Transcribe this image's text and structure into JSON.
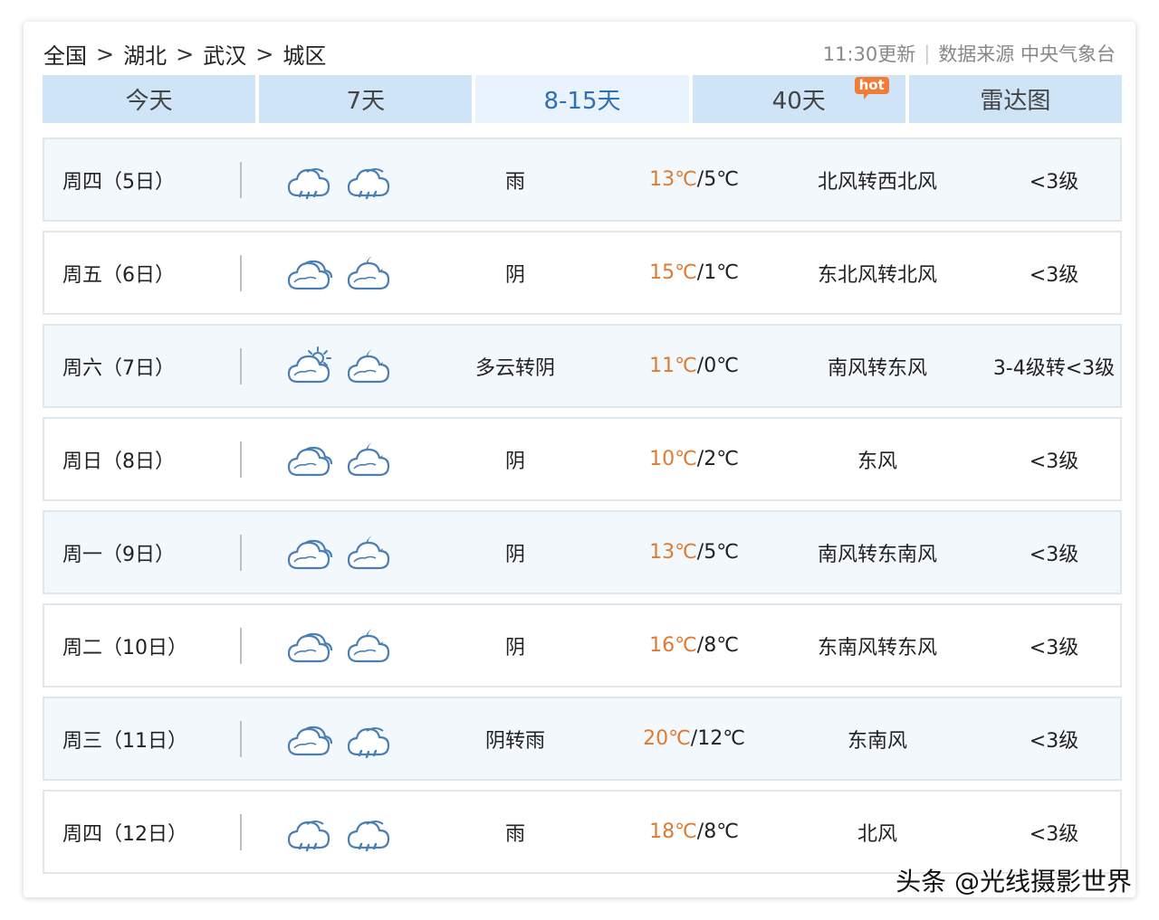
{
  "breadcrumb": [
    "全国",
    "湖北",
    "武汉",
    "城区"
  ],
  "breadcrumb_sep": ">",
  "meta": {
    "updated": "11:30更新",
    "divider": "|",
    "source": "数据来源 中央气象台"
  },
  "tabs": [
    {
      "label": "今天",
      "active": false
    },
    {
      "label": "7天",
      "active": false
    },
    {
      "label": "8-15天",
      "active": true
    },
    {
      "label": "40天",
      "active": false,
      "badge": "hot"
    },
    {
      "label": "雷达图",
      "active": false
    }
  ],
  "rows": [
    {
      "day": "周四（5日）",
      "icon_day": "rain-icon",
      "icon_night": "rain-icon",
      "weather": "雨",
      "high": "13℃",
      "low": "/5℃",
      "wind": "北风转西北风",
      "level": "<3级"
    },
    {
      "day": "周五（6日）",
      "icon_day": "overcast-icon",
      "icon_night": "cloudy-night-icon",
      "weather": "阴",
      "high": "15℃",
      "low": "/1℃",
      "wind": "东北风转北风",
      "level": "<3级"
    },
    {
      "day": "周六（7日）",
      "icon_day": "partly-cloudy-day-icon",
      "icon_night": "cloudy-night-icon",
      "weather": "多云转阴",
      "high": "11℃",
      "low": "/0℃",
      "wind": "南风转东风",
      "level": "3-4级转<3级"
    },
    {
      "day": "周日（8日）",
      "icon_day": "overcast-icon",
      "icon_night": "cloudy-night-icon",
      "weather": "阴",
      "high": "10℃",
      "low": "/2℃",
      "wind": "东风",
      "level": "<3级"
    },
    {
      "day": "周一（9日）",
      "icon_day": "overcast-icon",
      "icon_night": "cloudy-night-icon",
      "weather": "阴",
      "high": "13℃",
      "low": "/5℃",
      "wind": "南风转东南风",
      "level": "<3级"
    },
    {
      "day": "周二（10日）",
      "icon_day": "overcast-icon",
      "icon_night": "cloudy-night-icon",
      "weather": "阴",
      "high": "16℃",
      "low": "/8℃",
      "wind": "东南风转东风",
      "level": "<3级"
    },
    {
      "day": "周三（11日）",
      "icon_day": "overcast-icon",
      "icon_night": "rain-icon",
      "weather": "阴转雨",
      "high": "20℃",
      "low": "/12℃",
      "wind": "东南风",
      "level": "<3级"
    },
    {
      "day": "周四（12日）",
      "icon_day": "rain-icon",
      "icon_night": "rain-icon",
      "weather": "雨",
      "high": "18℃",
      "low": "/8℃",
      "wind": "北风",
      "level": "<3级"
    }
  ],
  "colors": {
    "tab_bg": "#cfe4f7",
    "tab_active_text": "#2f6fb3",
    "high_temp": "#e07a30",
    "icon_stroke": "#4a7fb5",
    "hot_badge": "#f27b35"
  },
  "watermark": "头条 @光线摄影世界"
}
